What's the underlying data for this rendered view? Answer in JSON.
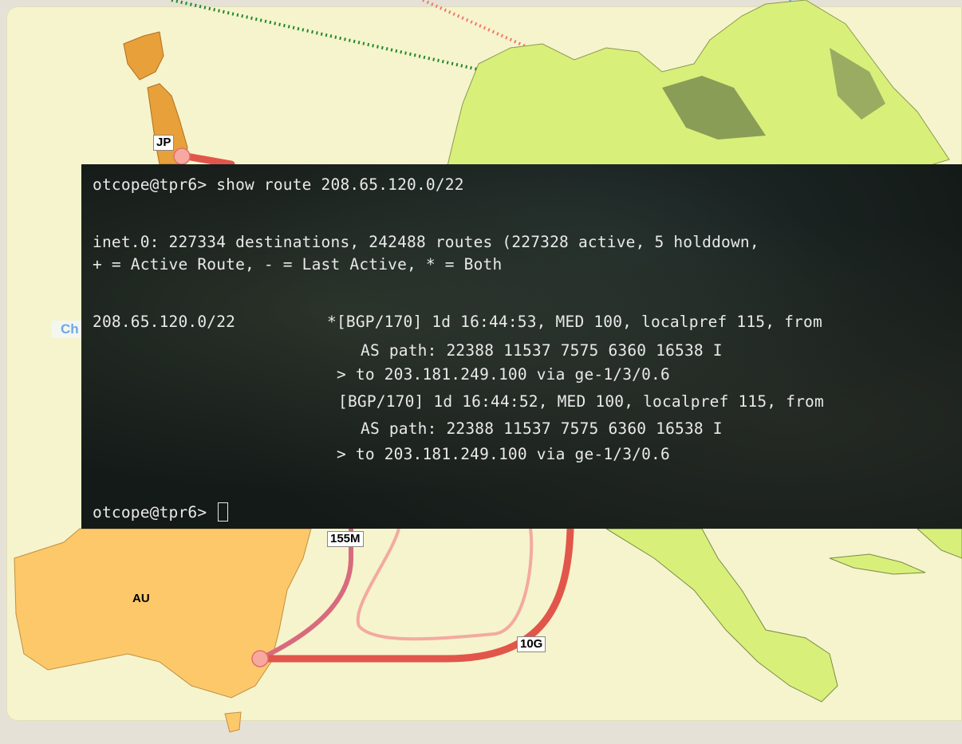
{
  "labels": {
    "jp": "JP",
    "au": "AU",
    "link_155m": "155M",
    "link_10g": "10G",
    "ch_partial": "Ch"
  },
  "terminal": {
    "prompt_cmd": "otcope@tpr6> show route 208.65.120.0/22",
    "summary": "inet.0: 227334 destinations, 242488 routes (227328 active, 5 holddown, ",
    "legend": "+ = Active Route, - = Last Active, * = Both",
    "prefix": "208.65.120.0/22",
    "route1": "*[BGP/170] 1d 16:44:53, MED 100, localpref 115, from",
    "aspath1": "AS path: 22388 11537 7575 6360 16538 I",
    "nexthop1": "> to 203.181.249.100 via ge-1/3/0.6",
    "route2": "[BGP/170] 1d 16:44:52, MED 100, localpref 115, from",
    "aspath2": "AS path: 22388 11537 7575 6360 16538 I",
    "nexthop2": "> to 203.181.249.100 via ge-1/3/0.6",
    "prompt_end": "otcope@tpr6> "
  },
  "colors": {
    "map_land_north_america": "#d8f07a",
    "map_land_australia": "#fdc86a",
    "map_land_japan": "#e8a03a",
    "link_thick_red": "#e2554a",
    "link_pink": "#d86a7e",
    "link_light_pink": "#f3aaa0",
    "dotted_green": "#1e8a2a",
    "dotted_red": "#f07a6a",
    "dotted_blue": "#6aa8f0",
    "slide_background": "#f6f4cc"
  }
}
